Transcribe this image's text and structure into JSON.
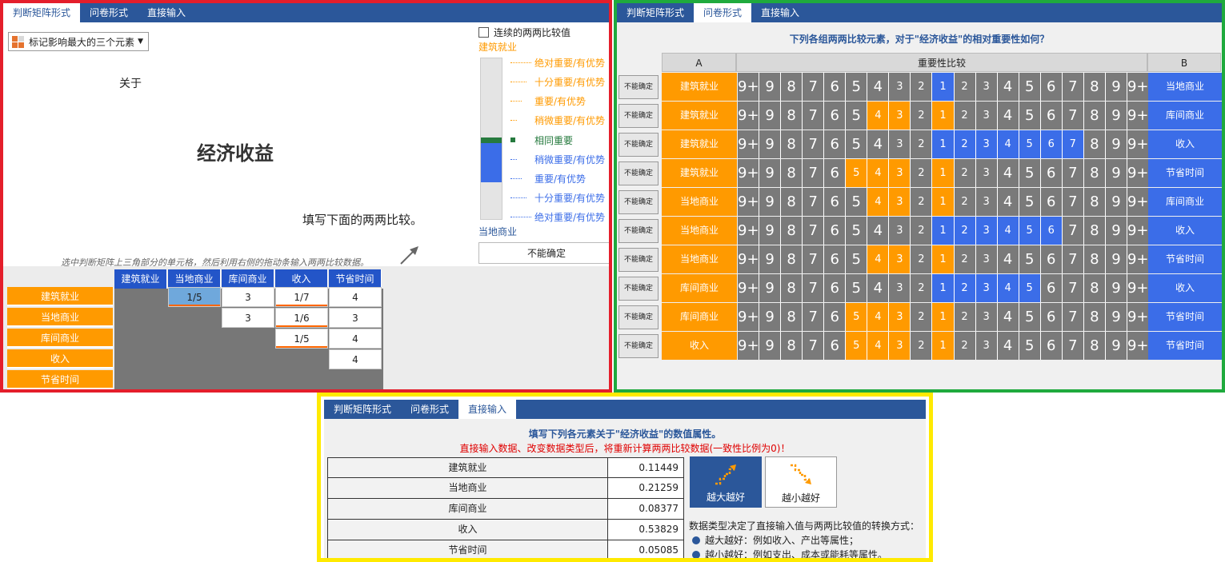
{
  "tabs": [
    "判断矩阵形式",
    "问卷形式",
    "直接输入"
  ],
  "matrix": {
    "dropdown": "标记影响最大的三个元素",
    "about": "关于",
    "goal": "经济收益",
    "fill_hint": "填写下面的两两比较。",
    "hint": "选中判断矩阵上三角部分的单元格，然后利用右侧的拖动条输入两两比较数据。",
    "checkbox_label": "连续的两两比较值",
    "slider_top_label": "建筑就业",
    "slider_bottom_label": "当地商业",
    "legend": [
      "绝对重要/有优势",
      "十分重要/有优势",
      "重要/有优势",
      "稍微重要/有优势",
      "相同重要",
      "稍微重要/有优势",
      "重要/有优势",
      "十分重要/有优势",
      "绝对重要/有优势"
    ],
    "not_sure": "不能确定",
    "elements": [
      "建筑就业",
      "当地商业",
      "库间商业",
      "收入",
      "节省时间"
    ],
    "columns": [
      "建筑就业",
      "当地商业",
      "库间商业",
      "收入",
      "节省时间"
    ],
    "rows": [
      [
        "1/5",
        "3",
        "1/7",
        "4"
      ],
      [
        "3",
        "1/6",
        "3"
      ],
      [
        "1/5",
        "4"
      ],
      [
        "4"
      ]
    ]
  },
  "questionnaire": {
    "title": "下列各组两两比较元素，对于\"经济收益\"的相对重要性如何？",
    "header_a": "A",
    "header_mid": "重要性比较",
    "header_b": "B",
    "not_sure": "不能确定",
    "scale": [
      "9+",
      "9",
      "8",
      "7",
      "6",
      "5",
      "4",
      "3",
      "2",
      "1",
      "2",
      "3",
      "4",
      "5",
      "6",
      "7",
      "8",
      "9",
      "9+"
    ],
    "pairs": [
      {
        "a": "建筑就业",
        "b": "当地商业",
        "side": "B",
        "level": 1
      },
      {
        "a": "建筑就业",
        "b": "库间商业",
        "side": "A",
        "level": 3
      },
      {
        "a": "建筑就业",
        "b": "收入",
        "side": "B",
        "level": 7
      },
      {
        "a": "建筑就业",
        "b": "节省时间",
        "side": "A",
        "level": 4
      },
      {
        "a": "当地商业",
        "b": "库间商业",
        "side": "A",
        "level": 3
      },
      {
        "a": "当地商业",
        "b": "收入",
        "side": "B",
        "level": 6
      },
      {
        "a": "当地商业",
        "b": "节省时间",
        "side": "A",
        "level": 3
      },
      {
        "a": "库间商业",
        "b": "收入",
        "side": "B",
        "level": 5
      },
      {
        "a": "库间商业",
        "b": "节省时间",
        "side": "A",
        "level": 4
      },
      {
        "a": "收入",
        "b": "节省时间",
        "side": "A",
        "level": 4
      }
    ]
  },
  "direct": {
    "title": "填写下列各元素关于\"经济收益\"的数值属性。",
    "warning": "直接输入数据、改变数据类型后，将重新计算两两比较数据(一致性比例为0)！",
    "items": [
      {
        "name": "建筑就业",
        "value": "0.11449"
      },
      {
        "name": "当地商业",
        "value": "0.21259"
      },
      {
        "name": "库间商业",
        "value": "0.08377"
      },
      {
        "name": "收入",
        "value": "0.53829"
      },
      {
        "name": "节省时间",
        "value": "0.05085"
      }
    ],
    "btn_larger": "越大越好",
    "btn_smaller": "越小越好",
    "desc": "数据类型决定了直接输入值与两两比较值的转换方式：",
    "bullets": [
      "越大越好：例如收入、产出等属性；",
      "越小越好：例如支出、成本或能耗等属性。"
    ]
  },
  "colors": {
    "orange": "#ff9a00",
    "blue": "#3b6de8",
    "navy": "#2b579a",
    "gray": "#7a7a7a"
  }
}
